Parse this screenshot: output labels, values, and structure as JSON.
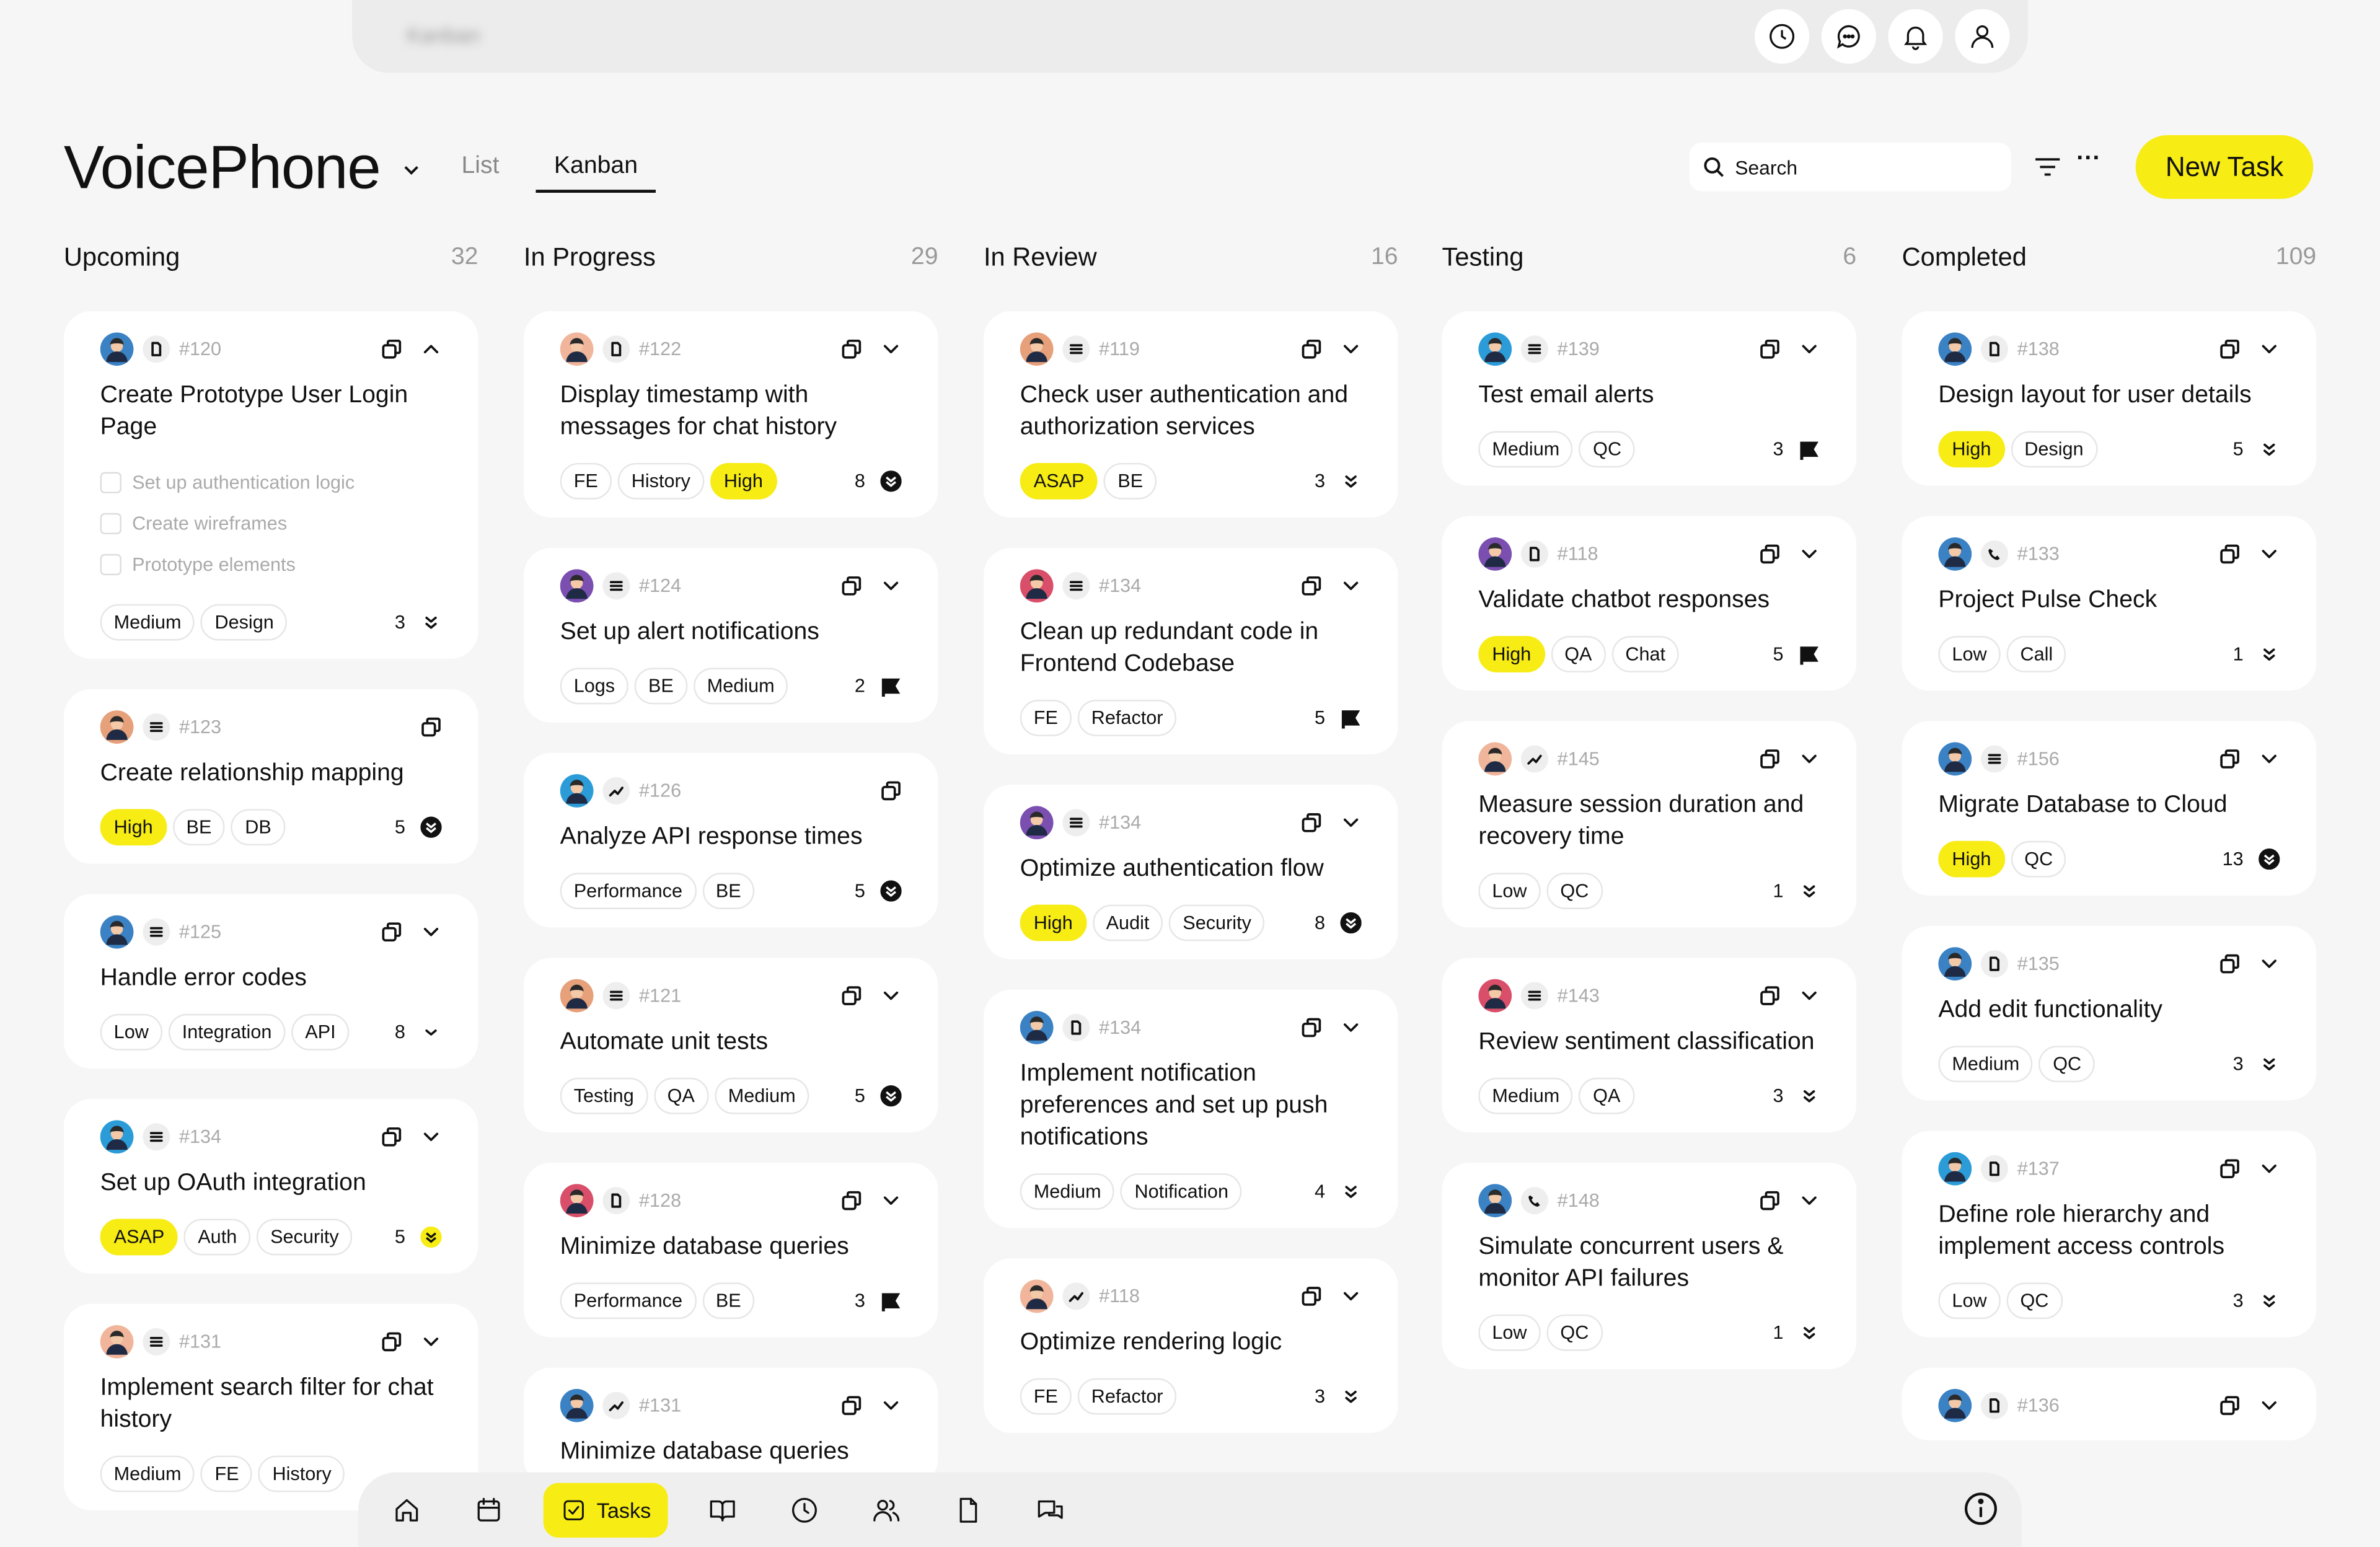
{
  "topbar": {
    "breadcrumb": "Kanban",
    "icons": [
      "clock-icon",
      "chat-icon",
      "bell-icon",
      "user-icon"
    ]
  },
  "header": {
    "project": "VoicePhone",
    "tabs": [
      "List",
      "Kanban"
    ],
    "active_tab": "Kanban",
    "search_placeholder": "Search",
    "new_task": "New Task"
  },
  "columns": [
    {
      "title": "Upcoming",
      "count": "32",
      "cards": [
        {
          "id": "#120",
          "avatar": "#3b82c4",
          "type": "doc",
          "expanded": true,
          "title": "Create Prototype User Login Page",
          "subtasks": [
            "Set up authentication logic",
            "Create wireframes",
            "Prototype elements"
          ],
          "tags": [
            "Medium",
            "Design"
          ],
          "n": "3",
          "p": "dchev"
        },
        {
          "id": "#123",
          "avatar": "#e6a07a",
          "type": "list",
          "nochev": true,
          "title": "Create relationship mapping",
          "tags": [
            "High",
            "BE",
            "DB"
          ],
          "n": "5",
          "p": "circ"
        },
        {
          "id": "#125",
          "avatar": "#3b82c4",
          "type": "list",
          "title": "Handle error codes",
          "tags": [
            "Low",
            "Integration",
            "API"
          ],
          "n": "8",
          "p": "chev"
        },
        {
          "id": "#134",
          "avatar": "#2b9cd8",
          "type": "list",
          "title": "Set up OAuth integration",
          "tags": [
            "ASAP",
            "Auth",
            "Security"
          ],
          "n": "5",
          "p": "circy"
        },
        {
          "id": "#131",
          "avatar": "#f0b59a",
          "type": "list",
          "title": "Implement search filter for chat history",
          "tags": [
            "Medium",
            "FE",
            "History"
          ],
          "n": "",
          "p": ""
        }
      ]
    },
    {
      "title": "In Progress",
      "count": "29",
      "cards": [
        {
          "id": "#122",
          "avatar": "#f0b59a",
          "type": "doc",
          "title": "Display timestamp with messages for chat history",
          "tags": [
            "FE",
            "History",
            "High"
          ],
          "n": "8",
          "p": "circ"
        },
        {
          "id": "#124",
          "avatar": "#7a4fb0",
          "type": "list",
          "title": "Set up alert notifications",
          "tags": [
            "Logs",
            "BE",
            "Medium"
          ],
          "n": "2",
          "p": "flag"
        },
        {
          "id": "#126",
          "avatar": "#2b9cd8",
          "type": "trend",
          "nochev": true,
          "title": "Analyze API response times",
          "tags": [
            "Performance",
            "BE"
          ],
          "n": "5",
          "p": "circ"
        },
        {
          "id": "#121",
          "avatar": "#e6a07a",
          "type": "list",
          "title": "Automate unit tests",
          "tags": [
            "Testing",
            "QA",
            "Medium"
          ],
          "n": "5",
          "p": "circ"
        },
        {
          "id": "#128",
          "avatar": "#d94f6a",
          "type": "doc",
          "title": "Minimize database queries",
          "tags": [
            "Performance",
            "BE"
          ],
          "n": "3",
          "p": "flag"
        },
        {
          "id": "#131",
          "avatar": "#3b82c4",
          "type": "trend",
          "title": "Minimize database queries",
          "tags": [],
          "n": "",
          "p": ""
        }
      ]
    },
    {
      "title": "In Review",
      "count": "16",
      "cards": [
        {
          "id": "#119",
          "avatar": "#e6a07a",
          "type": "list",
          "title": "Check user authentication and authorization services",
          "tags": [
            "ASAP",
            "BE"
          ],
          "n": "3",
          "p": "dchev"
        },
        {
          "id": "#134",
          "avatar": "#d94f6a",
          "type": "list",
          "title": "Clean up redundant code in Frontend Codebase",
          "tags": [
            "FE",
            "Refactor"
          ],
          "n": "5",
          "p": "flag"
        },
        {
          "id": "#134",
          "avatar": "#7a4fb0",
          "type": "list",
          "title": "Optimize authentication flow",
          "tags": [
            "High",
            "Audit",
            "Security"
          ],
          "n": "8",
          "p": "circ"
        },
        {
          "id": "#134",
          "avatar": "#3b82c4",
          "type": "doc",
          "title": "Implement notification preferences and set up push notifications",
          "tags": [
            "Medium",
            "Notification"
          ],
          "n": "4",
          "p": "dchev"
        },
        {
          "id": "#118",
          "avatar": "#f0b59a",
          "type": "trend",
          "title": "Optimize rendering logic",
          "tags": [
            "FE",
            "Refactor"
          ],
          "n": "3",
          "p": "dchev"
        }
      ]
    },
    {
      "title": "Testing",
      "count": "6",
      "cards": [
        {
          "id": "#139",
          "avatar": "#2b9cd8",
          "type": "list",
          "title": "Test email alerts",
          "tags": [
            "Medium",
            "QC"
          ],
          "n": "3",
          "p": "flag"
        },
        {
          "id": "#118",
          "avatar": "#7a4fb0",
          "type": "doc",
          "title": "Validate chatbot responses",
          "tags": [
            "High",
            "QA",
            "Chat"
          ],
          "n": "5",
          "p": "flag"
        },
        {
          "id": "#145",
          "avatar": "#f0b59a",
          "type": "trend",
          "title": "Measure session duration and recovery time",
          "tags": [
            "Low",
            "QC"
          ],
          "n": "1",
          "p": "dchev"
        },
        {
          "id": "#143",
          "avatar": "#d94f6a",
          "type": "list",
          "title": "Review sentiment classification",
          "tags": [
            "Medium",
            "QA"
          ],
          "n": "3",
          "p": "dchev"
        },
        {
          "id": "#148",
          "avatar": "#3b82c4",
          "type": "phone",
          "title": "Simulate concurrent users & monitor API failures",
          "tags": [
            "Low",
            "QC"
          ],
          "n": "1",
          "p": "dchev"
        }
      ]
    },
    {
      "title": "Completed",
      "count": "109",
      "cards": [
        {
          "id": "#138",
          "avatar": "#3b82c4",
          "type": "doc",
          "title": "Design layout for user details",
          "tags": [
            "High",
            "Design"
          ],
          "n": "5",
          "p": "dchev"
        },
        {
          "id": "#133",
          "avatar": "#3b82c4",
          "type": "phone",
          "title": "Project Pulse Check",
          "tags": [
            "Low",
            "Call"
          ],
          "n": "1",
          "p": "dchev"
        },
        {
          "id": "#156",
          "avatar": "#3b82c4",
          "type": "list",
          "title": "Migrate Database to Cloud",
          "tags": [
            "High",
            "QC"
          ],
          "n": "13",
          "p": "circ"
        },
        {
          "id": "#135",
          "avatar": "#3b82c4",
          "type": "doc",
          "title": "Add edit functionality",
          "tags": [
            "Medium",
            "QC"
          ],
          "n": "3",
          "p": "dchev"
        },
        {
          "id": "#137",
          "avatar": "#2b9cd8",
          "type": "doc",
          "title": "Define role hierarchy and implement access controls",
          "tags": [
            "Low",
            "QC"
          ],
          "n": "3",
          "p": "dchev"
        },
        {
          "id": "#136",
          "avatar": "#3b82c4",
          "type": "doc",
          "title": "",
          "tags": [],
          "n": "",
          "p": ""
        }
      ]
    }
  ],
  "nav": {
    "items": [
      "home-icon",
      "calendar-icon",
      "tasks-icon",
      "book-icon",
      "clock-icon",
      "users-icon",
      "file-icon",
      "chat-icon"
    ],
    "active_label": "Tasks"
  },
  "highlight_tags": [
    "High",
    "ASAP"
  ],
  "accent": "#f7ec14"
}
